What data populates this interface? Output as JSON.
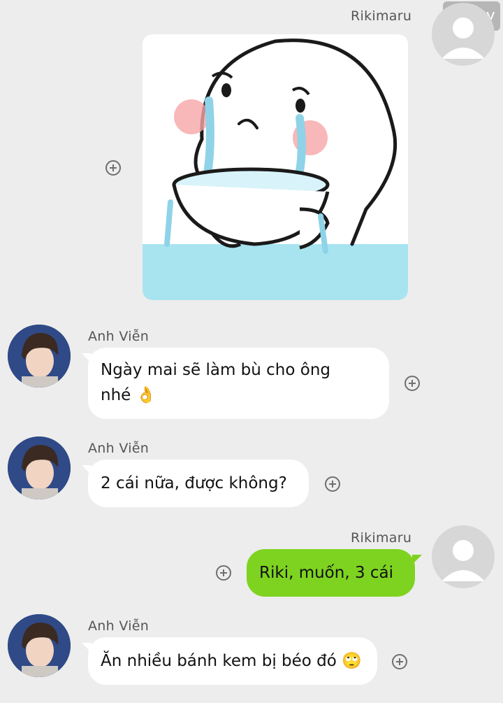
{
  "watermark": "99 joy",
  "messages": [
    {
      "sender": "Rikimaru",
      "type": "sticker",
      "side": "right"
    },
    {
      "sender": "Anh Viễn",
      "text_line1": "Ngày mai sẽ làm bù cho ông",
      "text_line2": "nhé",
      "emoji": "👌",
      "side": "left"
    },
    {
      "sender": "Anh Viễn",
      "text": "2 cái nữa, được không?",
      "side": "left"
    },
    {
      "sender": "Rikimaru",
      "text": "Riki, muốn, 3 cái",
      "side": "right"
    },
    {
      "sender": "Anh Viễn",
      "text": "Ăn nhiều bánh kem bị béo đó",
      "emoji": "🙄",
      "side": "left"
    }
  ],
  "icons": {
    "add": "plus-circle-icon",
    "avatar_default": "user-silhouette-icon",
    "sticker": "crying-bowl-sticker"
  },
  "colors": {
    "background": "#ededed",
    "incoming_bubble": "#ffffff",
    "outgoing_bubble": "#7ed321",
    "sticker_water": "#a8e4f0"
  }
}
